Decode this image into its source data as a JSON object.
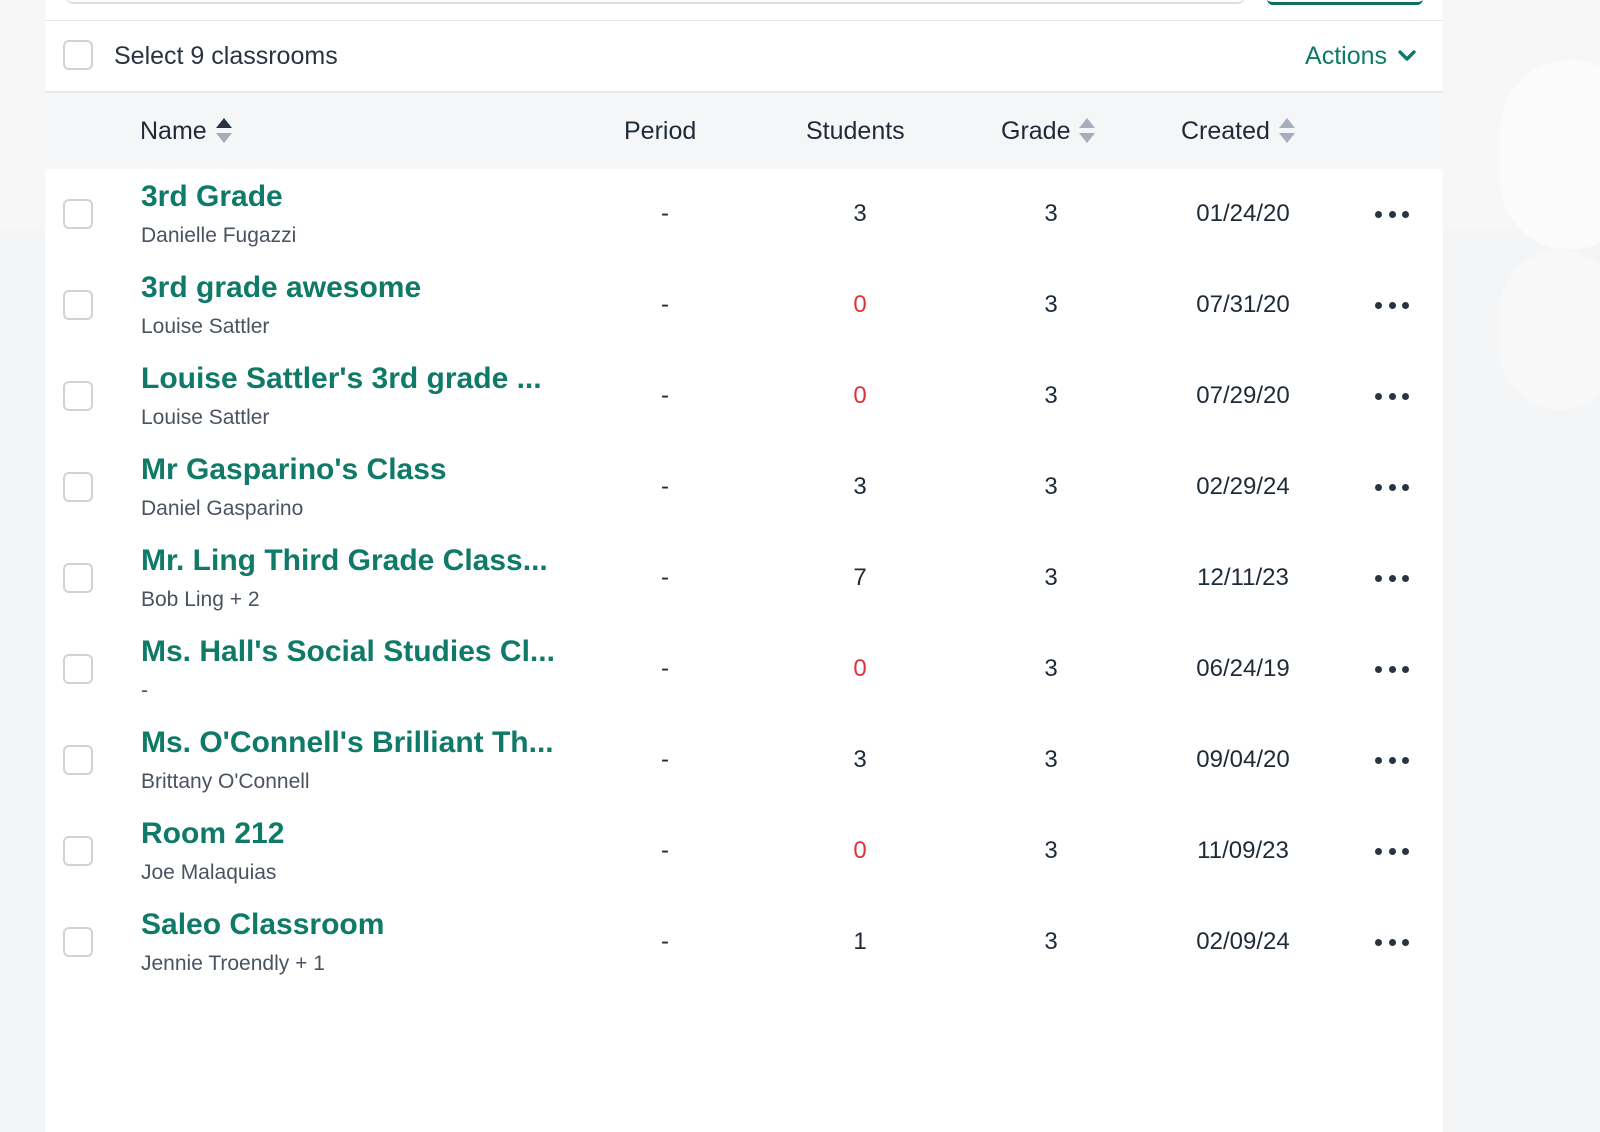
{
  "colors": {
    "accent": "#0f7a68",
    "zero_count": "#e0323d",
    "header_bg": "#f5f6f8"
  },
  "select_bar": {
    "label": "Select 9 classrooms",
    "actions_label": "Actions"
  },
  "table": {
    "columns": {
      "name": "Name",
      "period": "Period",
      "students": "Students",
      "grade": "Grade",
      "created": "Created"
    },
    "rows": [
      {
        "name": "3rd Grade",
        "teacher": "Danielle Fugazzi",
        "period": "-",
        "students": "3",
        "grade": "3",
        "created": "01/24/20"
      },
      {
        "name": "3rd grade awesome",
        "teacher": "Louise Sattler",
        "period": "-",
        "students": "0",
        "grade": "3",
        "created": "07/31/20"
      },
      {
        "name": "Louise Sattler's 3rd grade ...",
        "teacher": "Louise Sattler",
        "period": "-",
        "students": "0",
        "grade": "3",
        "created": "07/29/20"
      },
      {
        "name": "Mr Gasparino's Class",
        "teacher": "Daniel Gasparino",
        "period": "-",
        "students": "3",
        "grade": "3",
        "created": "02/29/24"
      },
      {
        "name": "Mr. Ling Third Grade Class...",
        "teacher": "Bob Ling + 2",
        "period": "-",
        "students": "7",
        "grade": "3",
        "created": "12/11/23"
      },
      {
        "name": "Ms. Hall's Social Studies Cl...",
        "teacher": "-",
        "period": "-",
        "students": "0",
        "grade": "3",
        "created": "06/24/19"
      },
      {
        "name": "Ms. O'Connell's Brilliant Th...",
        "teacher": "Brittany O'Connell",
        "period": "-",
        "students": "3",
        "grade": "3",
        "created": "09/04/20"
      },
      {
        "name": "Room 212",
        "teacher": "Joe Malaquias",
        "period": "-",
        "students": "0",
        "grade": "3",
        "created": "11/09/23"
      },
      {
        "name": "Saleo Classroom",
        "teacher": "Jennie Troendly + 1",
        "period": "-",
        "students": "1",
        "grade": "3",
        "created": "02/09/24"
      }
    ]
  }
}
